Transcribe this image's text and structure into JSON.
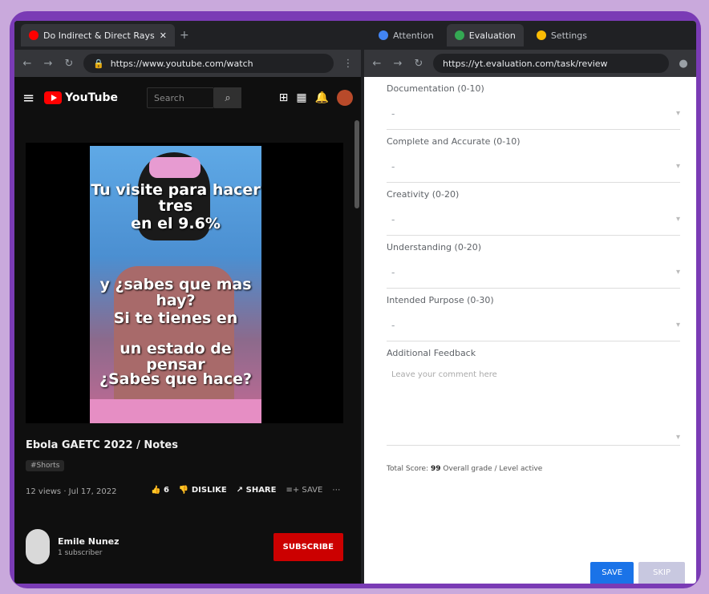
{
  "left": {
    "tab_title": "Do Indirect & Direct Rays",
    "url": "https://www.youtube.com/watch",
    "yt_logo": "YouTube",
    "search_placeholder": "Search",
    "captions": [
      "Tu visite para hacer tres",
      "en el 9.6%",
      "y ¿sabes que mas hay?",
      "Si te tienes en",
      "un estado de pensar",
      "¿Sabes que hace?"
    ],
    "video_title": "Ebola GAETC 2022 / Notes",
    "badge": "#Shorts",
    "meta": "12 views · Jul 17, 2022",
    "likes": "6",
    "dislike": "DISLIKE",
    "share": "SHARE",
    "save": "SAVE",
    "channel_name": "Emile Nunez",
    "channel_subs": "1 subscriber",
    "subscribe": "SUBSCRIBE"
  },
  "right": {
    "tabs": [
      "Attention",
      "Evaluation",
      "Settings"
    ],
    "url": "https://yt.evaluation.com/task/review",
    "fields": [
      {
        "label": "Documentation (0-10)",
        "value": "-"
      },
      {
        "label": "Complete and Accurate (0-10)",
        "value": "-"
      },
      {
        "label": "Creativity (0-20)",
        "value": "-"
      },
      {
        "label": "Understanding (0-20)",
        "value": "-"
      },
      {
        "label": "Intended Purpose (0-30)",
        "value": "-"
      }
    ],
    "feedback_label": "Additional Feedback",
    "feedback_placeholder": "Leave your comment here",
    "footnote_prefix": "Total Score:",
    "footnote_score": "99",
    "footnote_suffix": "Overall grade / Level active",
    "submit": "SAVE",
    "skip": "SKIP"
  },
  "colors": {
    "frame": "#7a3bb5",
    "youtube_red": "#ff0000",
    "subscribe_red": "#cc0000",
    "primary_blue": "#1a73e8"
  }
}
